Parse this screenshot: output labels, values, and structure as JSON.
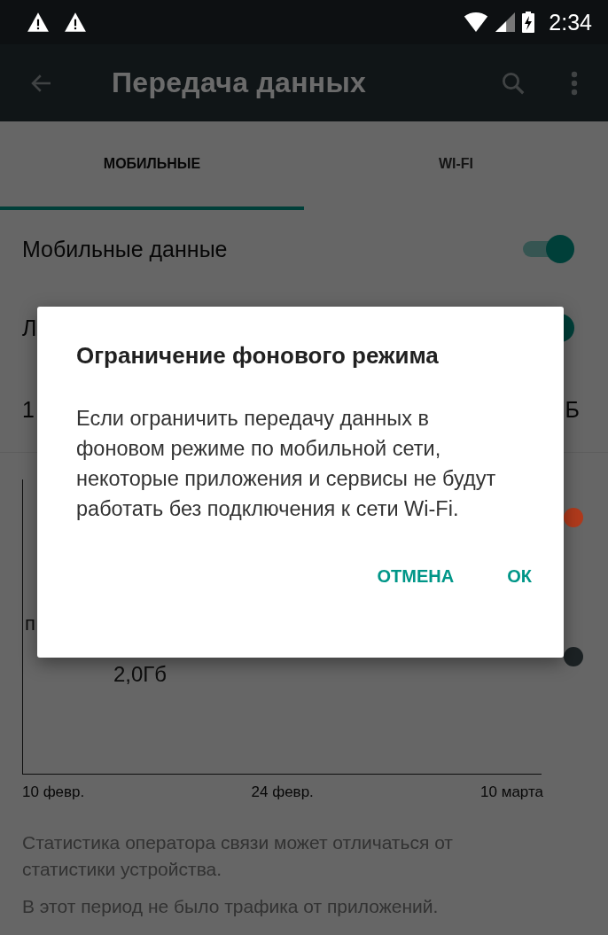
{
  "status_bar": {
    "time": "2:34"
  },
  "toolbar": {
    "title": "Передача данных"
  },
  "tabs": [
    {
      "label": "МОБИЛЬНЫЕ",
      "selected": true
    },
    {
      "label": "WI-FI",
      "selected": false
    }
  ],
  "settings": [
    {
      "kind": "switch",
      "label": "Мобильные данные",
      "on": true
    },
    {
      "kind": "switch",
      "label": "Л",
      "on": true
    },
    {
      "kind": "value",
      "label": "1",
      "value": "Б"
    }
  ],
  "chart": {
    "side_label": "п",
    "reading": "2,0Гб",
    "x_labels": [
      "10 февр.",
      "24 февр.",
      "10 марта"
    ],
    "handles": [
      {
        "color": "#b03a1c"
      },
      {
        "color": "#1c2224"
      }
    ]
  },
  "notes": [
    "Статистика оператора связи может отличаться от статистики устройства.",
    "В этот период не было трафика от приложений."
  ],
  "dialog": {
    "title": "Ограничение фонового режима",
    "message": "Если ограничить передачу данных в фоновом режиме по мобильной сети, некоторые приложения и сервисы не будут работать без подключения к сети Wi-Fi.",
    "buttons": [
      "ОТМЕНА",
      "ОК"
    ]
  }
}
